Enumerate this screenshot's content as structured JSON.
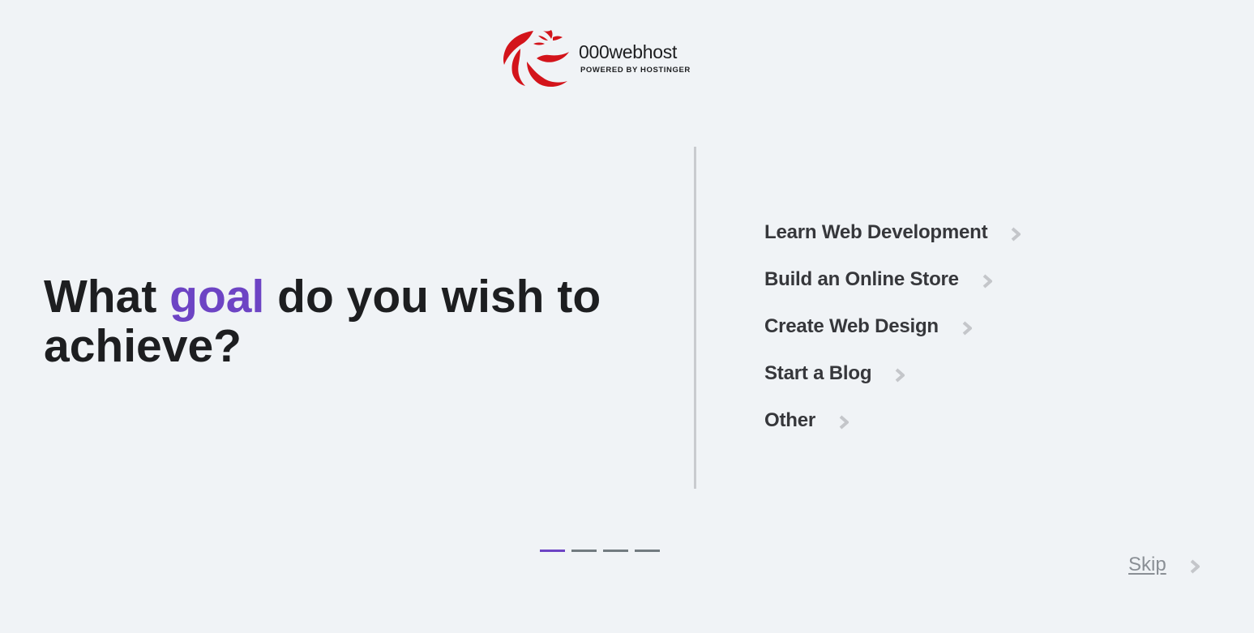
{
  "logo": {
    "wordmark": "000webhost",
    "tagline": "POWERED BY HOSTINGER",
    "brand_color": "#d3141b"
  },
  "heading": {
    "before": "What ",
    "accent": "goal",
    "after": " do you wish to achieve?",
    "accent_color": "#6d44c4"
  },
  "options": [
    {
      "label": "Learn Web Development",
      "icon": "chevron-right-icon"
    },
    {
      "label": "Build an Online Store",
      "icon": "chevron-right-icon"
    },
    {
      "label": "Create Web Design",
      "icon": "chevron-right-icon"
    },
    {
      "label": "Start a Blog",
      "icon": "chevron-right-icon"
    },
    {
      "label": "Other",
      "icon": "chevron-right-icon"
    }
  ],
  "progress": {
    "current_step": 1,
    "total_steps": 4,
    "active_color": "#6d44c4",
    "inactive_color": "#727b80"
  },
  "skip": {
    "label": "Skip",
    "icon": "chevron-right-icon"
  }
}
